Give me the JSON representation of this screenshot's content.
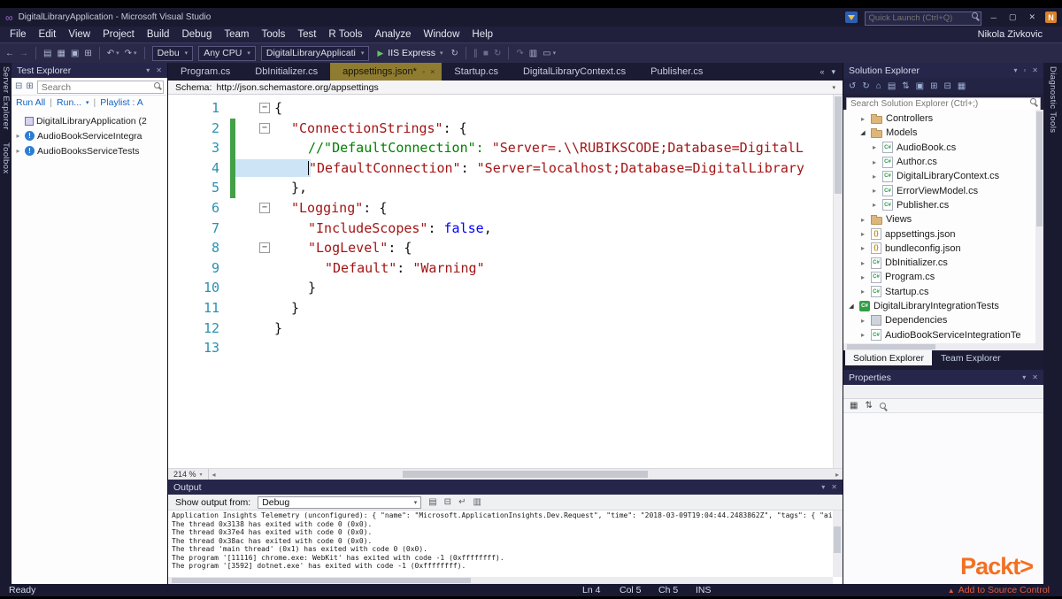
{
  "title_bar": {
    "app_title": "DigitalLibraryApplication - Microsoft Visual Studio",
    "quick_launch_placeholder": "Quick Launch (Ctrl+Q)",
    "overlay_badge": "N"
  },
  "menu_bar": {
    "items": [
      "File",
      "Edit",
      "View",
      "Project",
      "Build",
      "Debug",
      "Team",
      "Tools",
      "Test",
      "R Tools",
      "Analyze",
      "Window",
      "Help"
    ],
    "user_name": "Nikola Zivkovic"
  },
  "toolbar": {
    "config": "Debu",
    "platform": "Any CPU",
    "startup_project": "DigitalLibraryApplicati",
    "run_label": "IIS Express"
  },
  "left_tabs": [
    "Server Explorer",
    "Toolbox"
  ],
  "right_tabs": [
    "Diagnostic Tools"
  ],
  "test_explorer": {
    "title": "Test Explorer",
    "search_placeholder": "Search",
    "links": [
      "Run All",
      "Run...",
      "Playlist : A"
    ],
    "items": [
      {
        "label": "DigitalLibraryApplication (2",
        "icon": "test-group",
        "expander": ""
      },
      {
        "label": "AudioBookServiceIntegra",
        "icon": "test-notrun",
        "expander": "right"
      },
      {
        "label": "AudioBooksServiceTests",
        "icon": "test-notrun",
        "expander": "right"
      }
    ]
  },
  "editor": {
    "tabs": [
      {
        "label": "Program.cs",
        "active": false
      },
      {
        "label": "DbInitializer.cs",
        "active": false
      },
      {
        "label": "appsettings.json*",
        "active": true
      },
      {
        "label": "Startup.cs",
        "active": false
      },
      {
        "label": "DigitalLibraryContext.cs",
        "active": false
      },
      {
        "label": "Publisher.cs",
        "active": false
      }
    ],
    "schema_label": "Schema:",
    "schema_url": "http://json.schemastore.org/appsettings",
    "zoom": "214 %",
    "code": [
      {
        "n": 1,
        "fold": true,
        "ind": 0,
        "seg": [
          [
            "{",
            "p"
          ]
        ]
      },
      {
        "n": 2,
        "fold": true,
        "ind": 1,
        "chg": true,
        "seg": [
          [
            "\"ConnectionStrings\"",
            "k"
          ],
          [
            ": {",
            "p"
          ]
        ]
      },
      {
        "n": 3,
        "ind": 2,
        "chg": true,
        "seg": [
          [
            "//\"DefaultConnection\": ",
            "c"
          ],
          [
            "\"Server=.\\\\RUBIKSCODE;Database=DigitalL",
            "s"
          ]
        ]
      },
      {
        "n": 4,
        "ind": 2,
        "chg": true,
        "caret": true,
        "seg": [
          [
            "\"DefaultConnection\"",
            "k"
          ],
          [
            ": ",
            "p"
          ],
          [
            "\"Server=localhost;Database=DigitalLibrary",
            "s"
          ]
        ]
      },
      {
        "n": 5,
        "ind": 1,
        "chg": true,
        "seg": [
          [
            "},",
            "p"
          ]
        ]
      },
      {
        "n": 6,
        "fold": true,
        "ind": 1,
        "seg": [
          [
            "\"Logging\"",
            "k"
          ],
          [
            ": {",
            "p"
          ]
        ]
      },
      {
        "n": 7,
        "ind": 2,
        "seg": [
          [
            "\"IncludeScopes\"",
            "k"
          ],
          [
            ": ",
            "p"
          ],
          [
            "false",
            "w"
          ],
          [
            ",",
            "p"
          ]
        ]
      },
      {
        "n": 8,
        "fold": true,
        "ind": 2,
        "seg": [
          [
            "\"LogLevel\"",
            "k"
          ],
          [
            ": {",
            "p"
          ]
        ]
      },
      {
        "n": 9,
        "ind": 3,
        "seg": [
          [
            "\"Default\"",
            "k"
          ],
          [
            ": ",
            "p"
          ],
          [
            "\"Warning\"",
            "s"
          ]
        ]
      },
      {
        "n": 10,
        "ind": 2,
        "seg": [
          [
            "}",
            "p"
          ]
        ]
      },
      {
        "n": 11,
        "ind": 1,
        "seg": [
          [
            "}",
            "p"
          ]
        ]
      },
      {
        "n": 12,
        "ind": 0,
        "seg": [
          [
            "}",
            "p"
          ]
        ]
      },
      {
        "n": 13,
        "ind": 0,
        "seg": []
      }
    ]
  },
  "solution_explorer": {
    "title": "Solution Explorer",
    "search_placeholder": "Search Solution Explorer (Ctrl+;)",
    "tree": [
      {
        "label": "Controllers",
        "icon": "folder",
        "depth": 1,
        "exp": "right"
      },
      {
        "label": "Models",
        "icon": "folder",
        "depth": 1,
        "exp": "down"
      },
      {
        "label": "AudioBook.cs",
        "icon": "cs",
        "depth": 2,
        "exp": "right"
      },
      {
        "label": "Author.cs",
        "icon": "cs",
        "depth": 2,
        "exp": "right"
      },
      {
        "label": "DigitalLibraryContext.cs",
        "icon": "cs",
        "depth": 2,
        "exp": "right"
      },
      {
        "label": "ErrorViewModel.cs",
        "icon": "cs",
        "depth": 2,
        "exp": "right"
      },
      {
        "label": "Publisher.cs",
        "icon": "cs",
        "depth": 2,
        "exp": "right"
      },
      {
        "label": "Views",
        "icon": "folder",
        "depth": 1,
        "exp": "right"
      },
      {
        "label": "appsettings.json",
        "icon": "json",
        "depth": 1,
        "exp": "right"
      },
      {
        "label": "bundleconfig.json",
        "icon": "json",
        "depth": 1,
        "exp": "right"
      },
      {
        "label": "DbInitializer.cs",
        "icon": "cs",
        "depth": 1,
        "exp": "right"
      },
      {
        "label": "Program.cs",
        "icon": "cs",
        "depth": 1,
        "exp": "right"
      },
      {
        "label": "Startup.cs",
        "icon": "cs",
        "depth": 1,
        "exp": "right"
      },
      {
        "label": "DigitalLibraryIntegrationTests",
        "icon": "csproj",
        "depth": 0,
        "exp": "down"
      },
      {
        "label": "Dependencies",
        "icon": "deps",
        "depth": 1,
        "exp": "right"
      },
      {
        "label": "AudioBookServiceIntegrationTe",
        "icon": "cs",
        "depth": 1,
        "exp": "right"
      }
    ],
    "bottom_tabs": [
      {
        "label": "Solution Explorer",
        "active": true
      },
      {
        "label": "Team Explorer",
        "active": false
      }
    ]
  },
  "properties_panel": {
    "title": "Properties"
  },
  "output_panel": {
    "title": "Output",
    "source_label": "Show output from:",
    "source_value": "Debug",
    "lines": [
      "Application Insights Telemetry (unconfigured): { \"name\": \"Microsoft.ApplicationInsights.Dev.Request\", \"time\": \"2018-03-09T19:04:44.2483862Z\", \"tags\": { \"ai.operation.name\": \"GET ...",
      "The thread 0x3138 has exited with code 0 (0x0).",
      "The thread 0x37e4 has exited with code 0 (0x0).",
      "The thread 0x38ac has exited with code 0 (0x0).",
      "The thread 'main thread' (0x1) has exited with code 0 (0x0).",
      "The program '[11116] chrome.exe: WebKit' has exited with code -1 (0xffffffff).",
      "The program '[3592] dotnet.exe' has exited with code -1 (0xffffffff)."
    ]
  },
  "status_bar": {
    "ready": "Ready",
    "ln": "Ln 4",
    "col": "Col 5",
    "ch": "Ch 5",
    "mode": "INS",
    "source_control": "Add to Source Control"
  },
  "branding": {
    "logo": "Packt>"
  }
}
